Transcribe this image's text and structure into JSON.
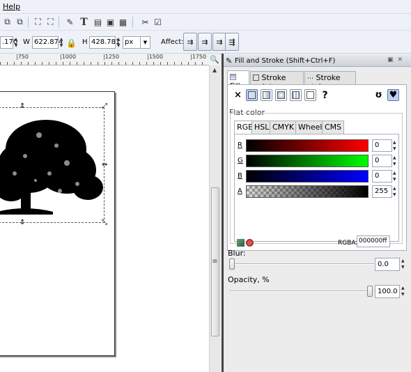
{
  "menubar": {
    "help": "Help"
  },
  "toolcontrols": {
    "x_value": ".170",
    "w_label": "W",
    "w_value": "622.874",
    "h_label": "H",
    "h_value": "428.781",
    "unit": "px",
    "affect_label": "Affect:"
  },
  "ruler": {
    "labels": [
      "|750",
      "|1000",
      "|1250",
      "|1500",
      "|1750"
    ]
  },
  "dialog": {
    "title": "Fill and Stroke (Shift+Ctrl+F)",
    "tabs": {
      "fill": "Fill",
      "stroke_paint": "Stroke paint",
      "stroke_style": "Stroke style"
    },
    "paint": {
      "none": "×",
      "unset": "?"
    },
    "flat_color": "Flat color",
    "color_tabs": [
      "RGB",
      "HSL",
      "CMYK",
      "Wheel",
      "CMS"
    ],
    "channels": [
      {
        "label": "R",
        "value": "0"
      },
      {
        "label": "G",
        "value": "0"
      },
      {
        "label": "B",
        "value": "0"
      },
      {
        "label": "A",
        "value": "255"
      }
    ],
    "rgba_label": "RGBA:",
    "rgba_value": "000000ff",
    "blur_label": "Blur:",
    "blur_value": "0.0",
    "blur_level": 0.0,
    "opacity_label": "Opacity, %",
    "opacity_value": "100.0",
    "opacity_level": 100.0
  }
}
